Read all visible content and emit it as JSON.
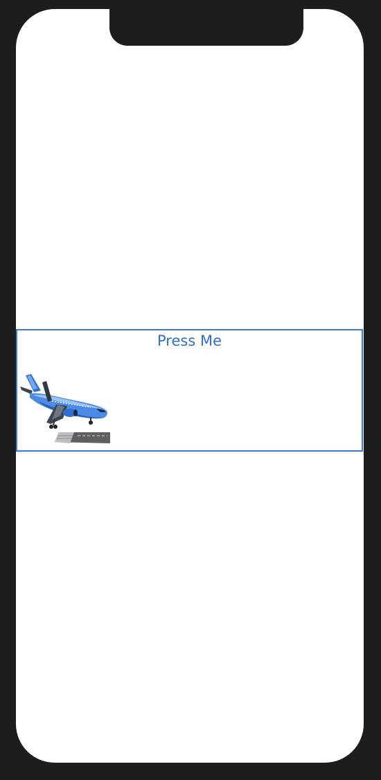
{
  "screen": {
    "button": {
      "label": "Press Me",
      "image_icon": "airplane-landing-icon",
      "border_color": "#3a7bd5",
      "text_color": "#2f6fd1"
    }
  },
  "device": {
    "frame_color": "#1c1e1e",
    "screen_color": "#ffffff"
  }
}
